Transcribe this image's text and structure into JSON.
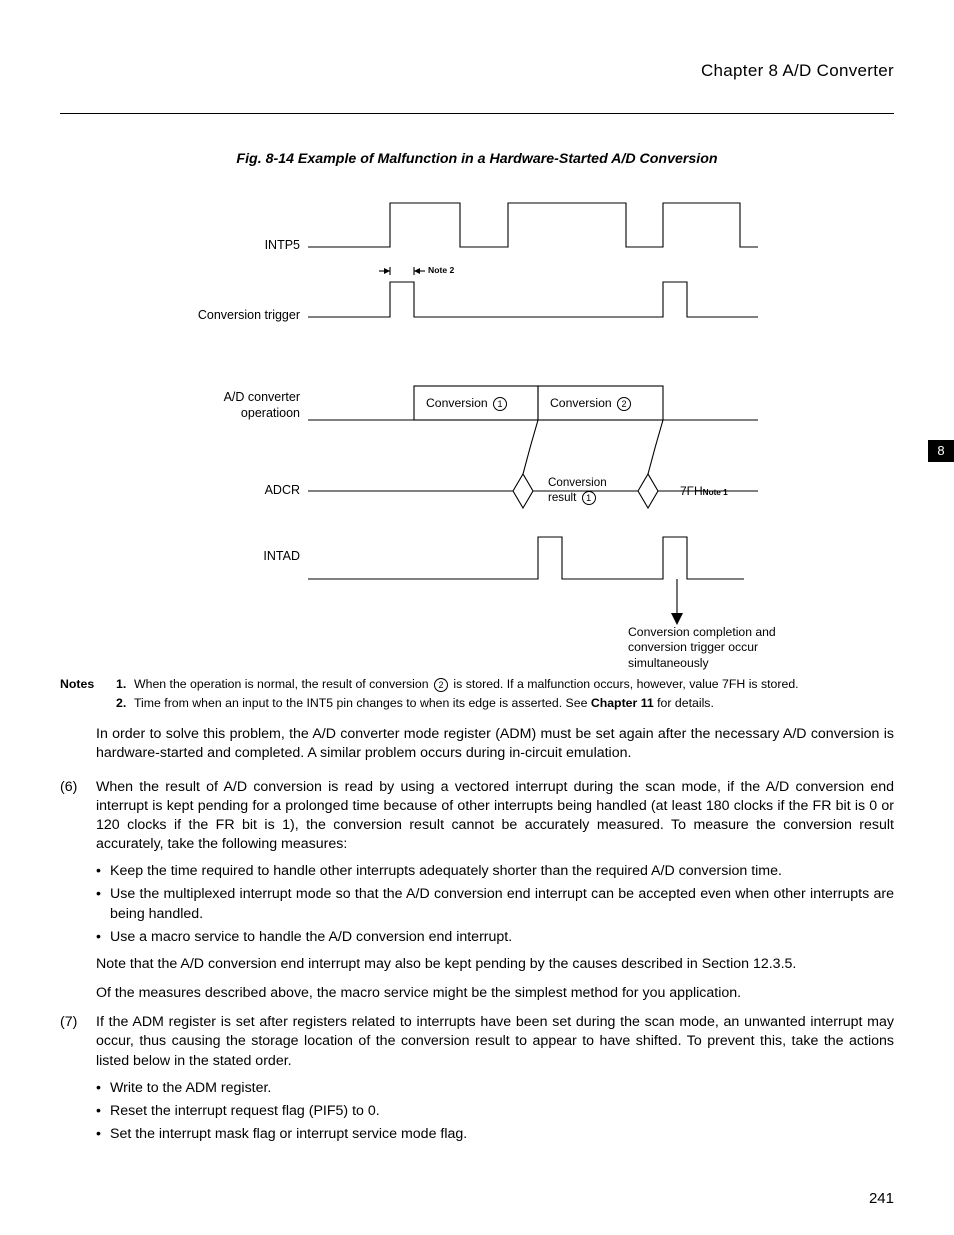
{
  "header": {
    "chapter_title": "Chapter 8  A/D Converter"
  },
  "figure": {
    "title": "Fig. 8-14  Example of Malfunction in a Hardware-Started A/D Conversion",
    "labels": {
      "intp5": "INTP5",
      "conv_trigger": "Conversion trigger",
      "ad_op_l1": "A/D converter",
      "ad_op_l2": "operatioon",
      "adcr": "ADCR",
      "intad": "INTAD"
    },
    "marks": {
      "note2": "Note 2",
      "conversion1_pre": "Conversion",
      "conversion2_pre": "Conversion",
      "conv_result_l1": "Conversion",
      "conv_result_l2": "result",
      "seven_fh": "7FH",
      "note1_sup": "Note 1",
      "footer_l1": "Conversion completion and",
      "footer_l2": "conversion trigger occur",
      "footer_l3": "simultaneously"
    },
    "circled": {
      "one": "1",
      "two": "2"
    }
  },
  "notes": {
    "label": "Notes",
    "n1_num": "1.",
    "n1_text_a": "When the operation is normal, the result of conversion ",
    "n1_text_b": " is stored.  If a malfunction occurs, however, value 7FH is stored.",
    "n2_num": "2.",
    "n2_text_a": "Time from when an input to the INT5 pin changes to when its edge is asserted.  See ",
    "n2_bold": "Chapter 11",
    "n2_text_b": " for details."
  },
  "para_intro": "In order to solve this problem, the A/D converter mode register (ADM) must be set again after the necessary A/D conversion is hardware-started and completed.  A similar problem occurs during in-circuit emulation.",
  "item6": {
    "marker": "(6)",
    "text": "When the result of A/D conversion is read by using a vectored interrupt during the scan mode, if the A/D conversion end interrupt is kept pending for a prolonged time because of other interrupts being handled (at least 180 clocks if the FR bit is 0 or 120 clocks if the FR bit is 1), the conversion result cannot be accurately measured.  To measure the conversion result accurately, take the following measures:",
    "bullets": [
      "Keep the time required to handle other interrupts adequately shorter than the required A/D conversion time.",
      "Use the multiplexed interrupt mode so that the A/D conversion end interrupt can be accepted even when other interrupts are being handled.",
      "Use a macro service to handle the A/D conversion end interrupt."
    ],
    "after1": "Note that the A/D conversion end interrupt may also be kept pending by the causes described in Section 12.3.5.",
    "after2": "Of the measures described above, the macro service might be the simplest method for you application."
  },
  "item7": {
    "marker": "(7)",
    "text": "If the ADM register is set after registers related to interrupts have been set during the scan mode, an unwanted interrupt may occur, thus causing the storage location of the conversion result to appear to have shifted.  To prevent this, take the actions listed below in the stated order.",
    "bullets": [
      "Write to the ADM register.",
      "Reset the interrupt request flag (PIF5) to 0.",
      "Set the interrupt mask flag or interrupt service mode flag."
    ]
  },
  "side_tab": "8",
  "page_number": "241"
}
